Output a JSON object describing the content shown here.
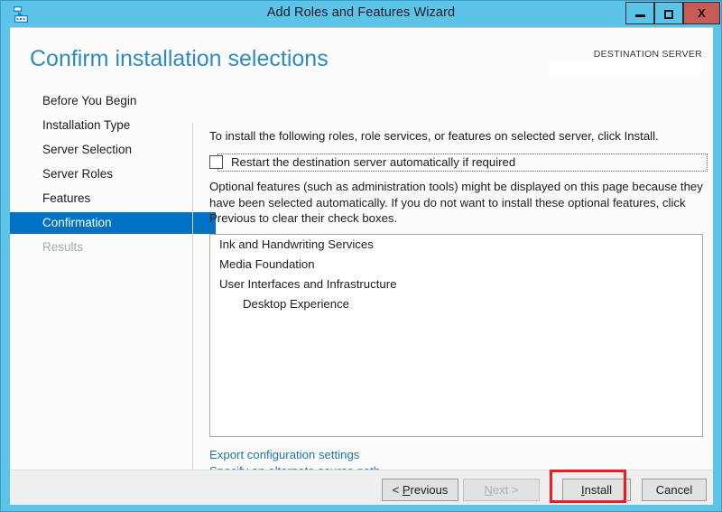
{
  "window": {
    "title": "Add Roles and Features Wizard",
    "icon": "server-manager-icon",
    "controls": {
      "minimize": "minimize-icon",
      "maximize": "maximize-icon",
      "close": "X"
    },
    "colors": {
      "frame": "#5cc4e8",
      "close_button": "#c75b56",
      "accent": "#0072c6",
      "title_heading": "#2e8bc0",
      "link": "#2277aa",
      "annotation": "#ee1b25"
    }
  },
  "header": {
    "page_title": "Confirm installation selections",
    "destination_label": "DESTINATION SERVER",
    "destination_value": ""
  },
  "sidebar": {
    "items": [
      {
        "label": "Before You Begin",
        "state": "normal"
      },
      {
        "label": "Installation Type",
        "state": "normal"
      },
      {
        "label": "Server Selection",
        "state": "normal"
      },
      {
        "label": "Server Roles",
        "state": "normal"
      },
      {
        "label": "Features",
        "state": "normal"
      },
      {
        "label": "Confirmation",
        "state": "active"
      },
      {
        "label": "Results",
        "state": "disabled"
      }
    ]
  },
  "content": {
    "intro_text": "To install the following roles, role services, or features on selected server, click Install.",
    "restart_checkbox": {
      "label": "Restart the destination server automatically if required",
      "checked": false,
      "focused": true
    },
    "optional_text": "Optional features (such as administration tools) might be displayed on this page because they have been selected automatically. If you do not want to install these optional features, click Previous to clear their check boxes.",
    "feature_list": [
      {
        "label": "Ink and Handwriting Services",
        "indent": 0
      },
      {
        "label": "Media Foundation",
        "indent": 0
      },
      {
        "label": "User Interfaces and Infrastructure",
        "indent": 0
      },
      {
        "label": "Desktop Experience",
        "indent": 1
      }
    ],
    "links": [
      {
        "label": "Export configuration settings"
      },
      {
        "label": "Specify an alternate source path"
      }
    ]
  },
  "footer": {
    "buttons": [
      {
        "label": "< Previous",
        "mnemonic": "P",
        "state": "enabled"
      },
      {
        "label": "Next >",
        "mnemonic": "N",
        "state": "disabled"
      },
      {
        "label": "Install",
        "mnemonic": "I",
        "state": "enabled",
        "highlighted": true
      },
      {
        "label": "Cancel",
        "mnemonic": "",
        "state": "enabled"
      }
    ]
  }
}
